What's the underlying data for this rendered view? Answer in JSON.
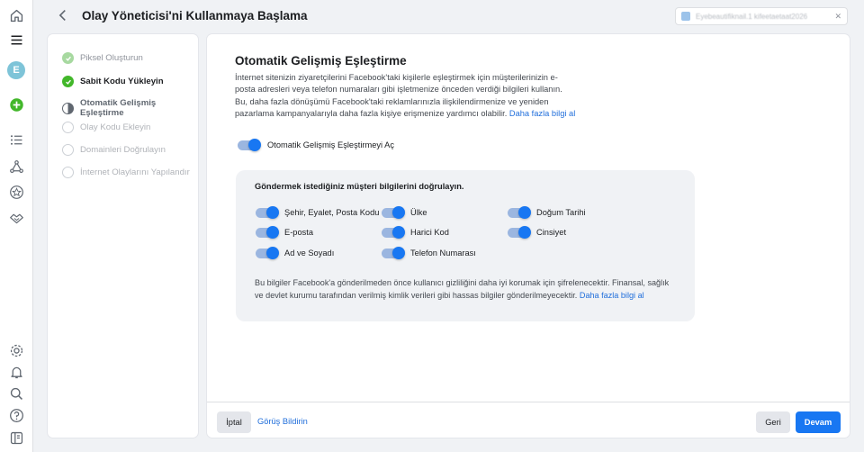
{
  "colors": {
    "accent": "#1877f2",
    "success": "#42b72a"
  },
  "nav": {
    "avatar_letter": "E",
    "icons": [
      "home-icon",
      "menu-icon",
      "avatar",
      "add-icon",
      "list-icon",
      "graph-icon",
      "star-icon",
      "handshake-icon",
      "settings-icon",
      "bell-icon",
      "search-icon",
      "help-icon",
      "panel-icon"
    ]
  },
  "header": {
    "title": "Olay Yöneticisi'ni Kullanmaya Başlama",
    "account_text": "Eyebeautifiknail.1 kifeetaetaat2026"
  },
  "steps": [
    {
      "label": "Piksel Oluşturun",
      "state": "done-light"
    },
    {
      "label": "Sabit Kodu Yükleyin",
      "state": "done"
    },
    {
      "label": "Otomatik Gelişmiş Eşleştirme",
      "state": "current"
    },
    {
      "label": "Olay Kodu Ekleyin",
      "state": "todo"
    },
    {
      "label": "Domainleri Doğrulayın",
      "state": "todo"
    },
    {
      "label": "İnternet Olaylarını Yapılandır",
      "state": "todo"
    }
  ],
  "main": {
    "heading": "Otomatik Gelişmiş Eşleştirme",
    "description": "İnternet sitenizin ziyaretçilerini Facebook'taki kişilerle eşleştirmek için müşterilerinizin e-posta adresleri veya telefon numaraları gibi işletmenize önceden verdiği bilgileri kullanın. Bu, daha fazla dönüşümü Facebook'taki reklamlarınızla ilişkilendirmenize ve yeniden pazarlama kampanyalarıyla daha fazla kişiye erişmenize yardımcı olabilir.",
    "learn_more": "Daha fazla bilgi al",
    "master_toggle_label": "Otomatik Gelişmiş Eşleştirmeyi Aç",
    "master_toggle_on": true,
    "panel": {
      "heading": "Göndermek istediğiniz müşteri bilgilerini doğrulayın.",
      "options": [
        {
          "label": "Şehir, Eyalet, Posta Kodu",
          "on": true
        },
        {
          "label": "Ülke",
          "on": true
        },
        {
          "label": "Doğum Tarihi",
          "on": true
        },
        {
          "label": "E-posta",
          "on": true
        },
        {
          "label": "Harici Kod",
          "on": true
        },
        {
          "label": "Cinsiyet",
          "on": true
        },
        {
          "label": "Ad ve Soyadı",
          "on": true
        },
        {
          "label": "Telefon Numarası",
          "on": true
        }
      ],
      "note": "Bu bilgiler Facebook'a gönderilmeden önce kullanıcı gizliliğini daha iyi korumak için şifrelenecektir. Finansal, sağlık ve devlet kurumu tarafından verilmiş kimlik verileri gibi hassas bilgiler gönderilmeyecektir.",
      "note_link": "Daha fazla bilgi al"
    }
  },
  "footer": {
    "cancel": "İptal",
    "feedback": "Görüş Bildirin",
    "back": "Geri",
    "continue": "Devam"
  }
}
